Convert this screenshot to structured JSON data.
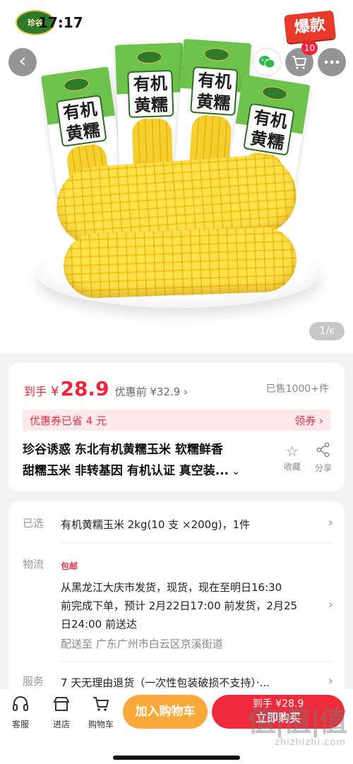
{
  "status_bar": {
    "time": "17:17",
    "brand_logo_text": "珍谷"
  },
  "header": {
    "hot_tag": "爆款",
    "cart_badge": "10",
    "back_icon": "chevron-left-icon",
    "wechat_icon": "wechat-icon",
    "cart_icon": "cart-icon",
    "more_icon": "more-icon"
  },
  "gallery": {
    "package_title": "有机黄糯",
    "page_current": "1",
    "page_total": "6"
  },
  "price_card": {
    "price_prefix": "到手",
    "currency": "¥",
    "price": "28.9",
    "original_price": "优惠前 ¥32.9 ›",
    "sold_count": "已售1000+件",
    "coupon_text": "优惠券已省 4 元",
    "coupon_action": "领券 ›",
    "title_line1": "珍谷诱惑 东北有机黄糯玉米 软糯鲜香",
    "title_line2": "甜糯玉米 非转基因 有机认证 真空装...",
    "favorite_label": "收藏",
    "share_label": "分享"
  },
  "detail_card": {
    "selected_label": "已选",
    "selected_value": "有机黄糯玉米 2kg(10 支 ×200g)，1件",
    "logistics_label": "物流",
    "shipping_tag": "包邮",
    "logistics_line1": "从黑龙江大庆市发货，现货，现在至明日16:30",
    "logistics_line2": "前完成下单，预计 2月22日17:00 前发货，2月25",
    "logistics_line3": "日24:00 前送达",
    "deliver_to": "配送至 广东广州市白云区京溪街道",
    "service_label": "服务",
    "service_value": "7 天无理由退货（一次性包装破损不支持）·..."
  },
  "bottom_bar": {
    "customer_service": "客服",
    "store": "进店",
    "cart": "购物车",
    "add_to_cart": "加入购物车",
    "buy_price": "到手 ¥28.9",
    "buy_label": "立即购买"
  },
  "watermark": {
    "logo": "值|值|值",
    "url": "zhizhizhi.com"
  },
  "colors": {
    "accent_red": "#ef2a3b",
    "add_cart_orange": "#f9a93a",
    "coupon_bg": "#fde9ea"
  }
}
